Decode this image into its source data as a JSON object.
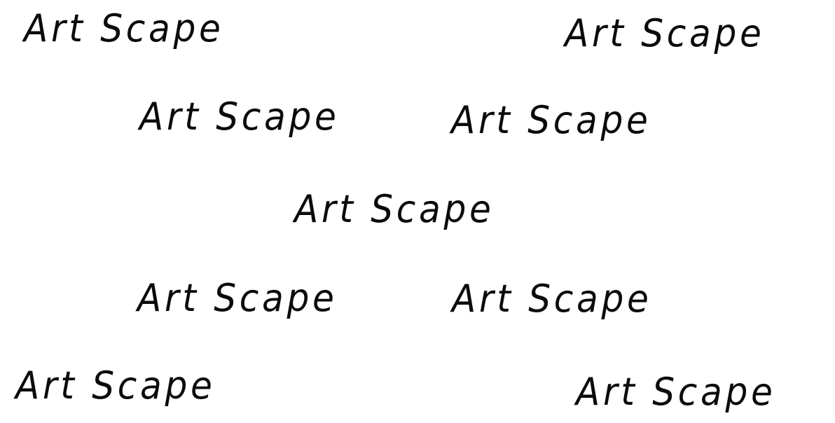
{
  "wordmarks": [
    "Art Scape",
    "Art Scape",
    "Art Scape",
    "Art Scape",
    "Art Scape",
    "Art Scape",
    "Art Scape",
    "Art Scape",
    "Art Scape"
  ],
  "colors": {
    "background": "#ffffff",
    "text": "#0b0b0b"
  }
}
